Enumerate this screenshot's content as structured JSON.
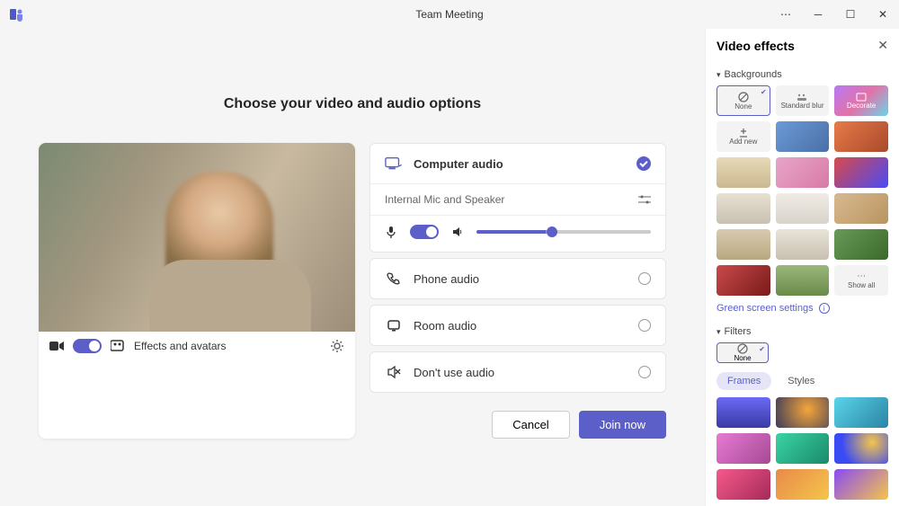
{
  "window": {
    "title": "Team Meeting"
  },
  "heading": "Choose your video and audio options",
  "video_toolbar": {
    "effects_label": "Effects and avatars"
  },
  "audio": {
    "computer": "Computer audio",
    "device_line": "Internal Mic and Speaker",
    "phone": "Phone audio",
    "room": "Room audio",
    "none": "Don't use audio"
  },
  "buttons": {
    "cancel": "Cancel",
    "join": "Join now"
  },
  "panel": {
    "title": "Video effects",
    "section_backgrounds": "Backgrounds",
    "section_filters": "Filters",
    "green_screen": "Green screen settings",
    "tiles": {
      "none": "None",
      "standard_blur": "Standard blur",
      "decorate": "Decorate",
      "add_new": "Add new",
      "show_all": "Show all"
    },
    "tabs": {
      "frames": "Frames",
      "styles": "Styles"
    }
  }
}
